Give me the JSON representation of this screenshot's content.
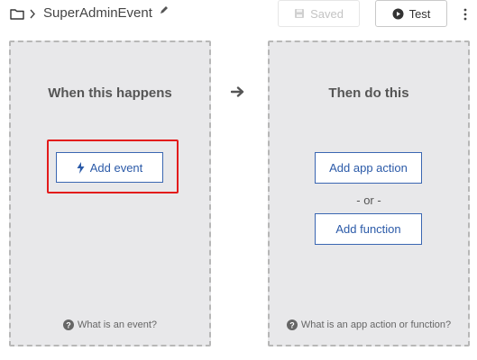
{
  "header": {
    "workflow_name": "SuperAdminEvent",
    "saved_label": "Saved",
    "test_label": "Test"
  },
  "trigger_panel": {
    "title": "When this happens",
    "add_event_label": "Add event",
    "help_text": "What is an event?"
  },
  "action_panel": {
    "title": "Then do this",
    "add_action_label": "Add app action",
    "or_text": "- or -",
    "add_function_label": "Add function",
    "help_text": "What is an app action or function?"
  },
  "colors": {
    "accent": "#2b5aa8",
    "highlight": "#e31b1b",
    "panel_bg": "#e8e8ea"
  }
}
